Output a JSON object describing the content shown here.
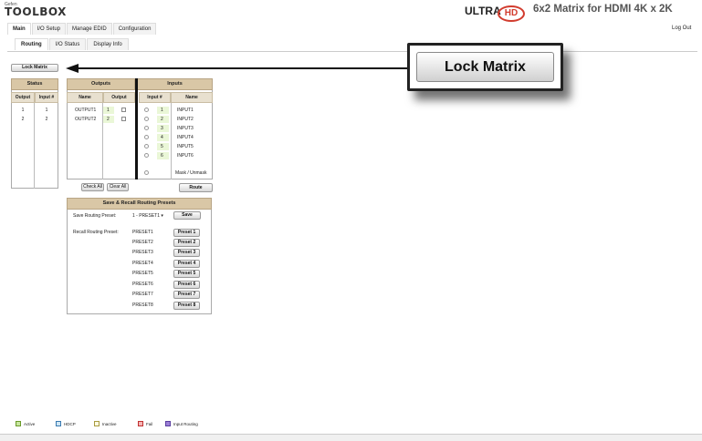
{
  "header": {
    "logo_small": "Gefen",
    "logo_big": "TOOLBOX",
    "brand_ultra": "ULTRA",
    "brand_hd": "HD",
    "product_title": "6x2 Matrix for HDMI 4K x 2K",
    "logout": "Log Out"
  },
  "main_tabs": [
    {
      "label": "Main",
      "active": true
    },
    {
      "label": "I/O Setup",
      "active": false
    },
    {
      "label": "Manage EDID",
      "active": false
    },
    {
      "label": "Configuration",
      "active": false
    }
  ],
  "sub_tabs": [
    {
      "label": "Routing",
      "active": true
    },
    {
      "label": "I/O Status",
      "active": false
    },
    {
      "label": "Display Info",
      "active": false
    }
  ],
  "lock_matrix_label": "Lock Matrix",
  "status": {
    "title": "Status",
    "col_output": "Output",
    "col_input": "Input #",
    "rows": [
      {
        "output": "1",
        "input": "1"
      },
      {
        "output": "2",
        "input": "2"
      }
    ]
  },
  "outputs": {
    "title": "Outputs",
    "col_name": "Name",
    "col_output": "Output",
    "rows": [
      {
        "name": "OUTPUT1",
        "num": "1"
      },
      {
        "name": "OUTPUT2",
        "num": "2"
      }
    ]
  },
  "inputs": {
    "title": "Inputs",
    "col_num": "Input #",
    "col_name": "Name",
    "rows": [
      {
        "num": "1",
        "name": "INPUT1"
      },
      {
        "num": "2",
        "name": "INPUT2"
      },
      {
        "num": "3",
        "name": "INPUT3"
      },
      {
        "num": "4",
        "name": "INPUT4"
      },
      {
        "num": "5",
        "name": "INPUT5"
      },
      {
        "num": "6",
        "name": "INPUT6"
      },
      {
        "num": "",
        "name": "Mask / Unmask"
      }
    ]
  },
  "check_all": "Check All",
  "clear_all": "Clear All",
  "route": "Route",
  "presets": {
    "title": "Save & Recall Routing Presets",
    "save_label": "Save Routing Preset:",
    "save_select": "1 - PRESET1",
    "save_button": "Save",
    "recall_label": "Recall Routing Preset:",
    "items": [
      {
        "name": "PRESET1",
        "button": "Preset 1"
      },
      {
        "name": "PRESET2",
        "button": "Preset 2"
      },
      {
        "name": "PRESET3",
        "button": "Preset 3"
      },
      {
        "name": "PRESET4",
        "button": "Preset 4"
      },
      {
        "name": "PRESET5",
        "button": "Preset 5"
      },
      {
        "name": "PRESET6",
        "button": "Preset 6"
      },
      {
        "name": "PRESET7",
        "button": "Preset 7"
      },
      {
        "name": "PRESET8",
        "button": "Preset 8"
      }
    ]
  },
  "callout_label": "Lock Matrix",
  "legend": [
    {
      "label": "Active",
      "color": "#c8e6a0",
      "border": "#6a9a2a"
    },
    {
      "label": "HDCP",
      "color": "#cfe6f5",
      "border": "#3a7ab0"
    },
    {
      "label": "Inactive",
      "color": "#fffbe0",
      "border": "#a89a40"
    },
    {
      "label": "Fail",
      "color": "#f5b5b5",
      "border": "#c03030"
    },
    {
      "label": "Input Routing",
      "color": "#9b7fd6",
      "border": "#5a3ea0"
    }
  ]
}
